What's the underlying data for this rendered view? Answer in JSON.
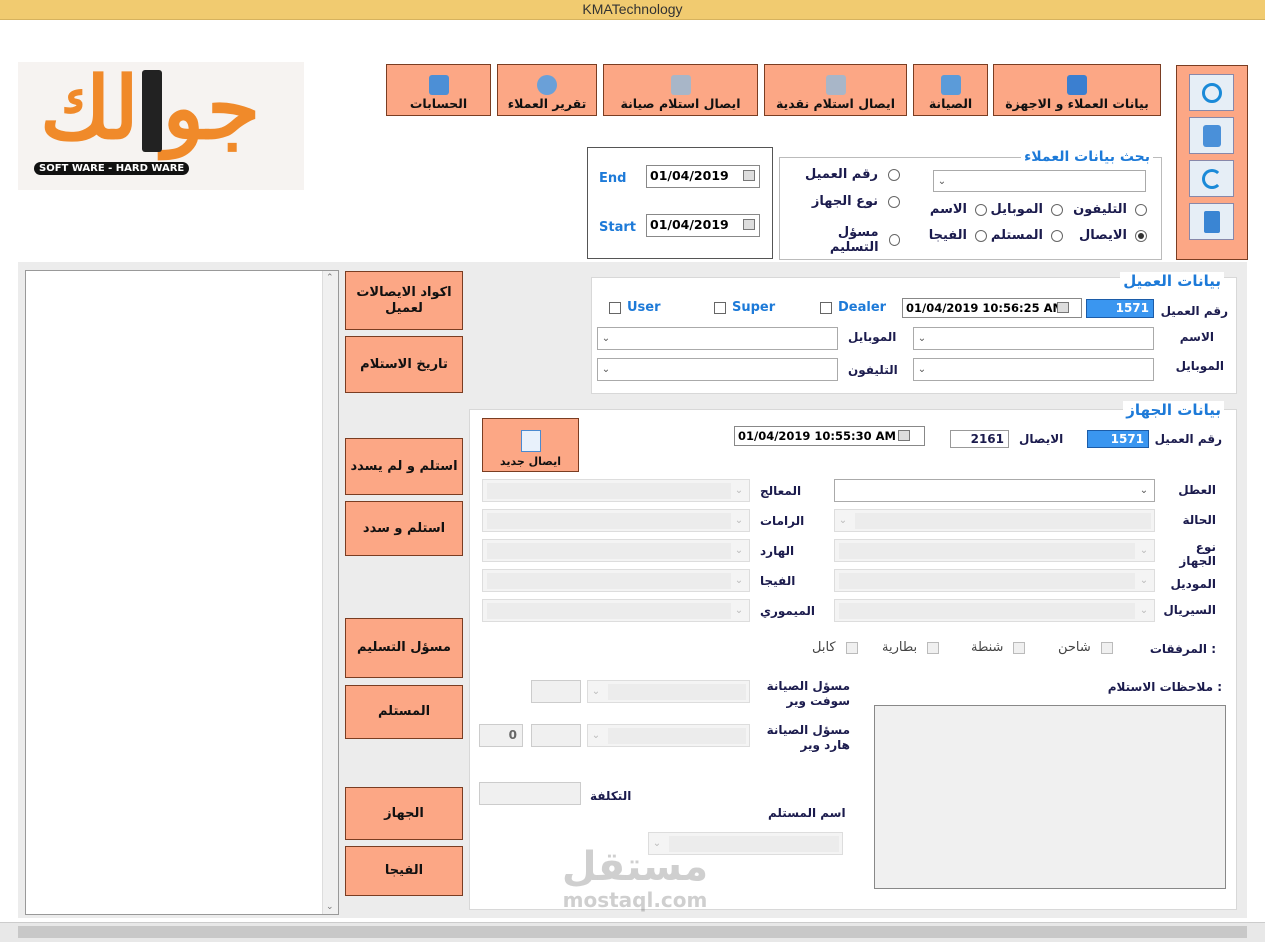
{
  "window": {
    "title": "KMATechnology"
  },
  "logo": {
    "arabic": "جوالك",
    "subtitle": "SOFT WARE - HARD WARE"
  },
  "toolbar": {
    "customers_devices": "بيانات العملاء و الاجهزة",
    "maintenance": "الصيانة",
    "cash_receipt": "ايصال استلام نقدية",
    "maintenance_receipt": "ايصال استلام صيانة",
    "customers_report": "تقرير العملاء",
    "accounts": "الحسابات"
  },
  "search": {
    "title": "بحث بيانات العملاء",
    "opt_phone": "التليفون",
    "opt_mobile": "الموبايل",
    "opt_name": "الاسم",
    "opt_receipt": "الايصال",
    "opt_receiver": "المستلم",
    "opt_vga": "الفيجا",
    "opt_customer_no": "رقم العميل",
    "opt_device_type": "نوع الجهاز",
    "opt_delivery_resp": "مسؤل التسليم"
  },
  "dates": {
    "end_label": "End",
    "end_value": "01/04/2019",
    "start_label": "Start",
    "start_value": "01/04/2019"
  },
  "side": {
    "codes": "اكواد الايصالات لعميل",
    "receive_date": "تاريخ الاستلام",
    "received_unpaid": "استلم و لم يسدد",
    "received_paid": "استلم و سدد",
    "delivery_resp": "مسؤل التسليم",
    "receiver": "المستلم",
    "device": "الجهاز",
    "vga": "الفيجا"
  },
  "customer": {
    "title": "بيانات العميل",
    "no_label": "رقم العميل",
    "no_value": "1571",
    "datetime": "01/04/2019  10:56:25 AM",
    "dealer": "Dealer",
    "super": "Super",
    "user": "User",
    "name_label": "الاسم",
    "mobile_label": "الموبايل",
    "mobile2_label": "الموبايل",
    "phone_label": "التليفون"
  },
  "device": {
    "title": "بيانات الجهاز",
    "cust_no_label": "رقم العميل",
    "cust_no_value": "1571",
    "receipt_label": "الايصال",
    "receipt_value": "2161",
    "datetime": "01/04/2019  10:55:30 AM",
    "new_receipt": "ايصال جديد",
    "fault": "العطل",
    "status": "الحالة",
    "type": "نوع الجهاز",
    "model": "الموديل",
    "serial": "السيريال",
    "cpu": "المعالج",
    "ram": "الرامات",
    "hdd": "الهارد",
    "vga": "الفيجا",
    "memory": "الميموري",
    "attachments": "المرفقات :",
    "charger": "شاحن",
    "bag": "شنطة",
    "battery": "بطارية",
    "cable": "كابل",
    "notes": "ملاحظات الاستلام :",
    "sw_resp": "مسؤل الصيانة سوفت وير",
    "hw_resp": "مسؤل الصيانة هارد وير",
    "hw_value": "0",
    "cost": "التكلفة",
    "receiver_name": "اسم المستلم"
  },
  "watermark": {
    "ar": "مستقل",
    "en": "mostaql.com"
  }
}
